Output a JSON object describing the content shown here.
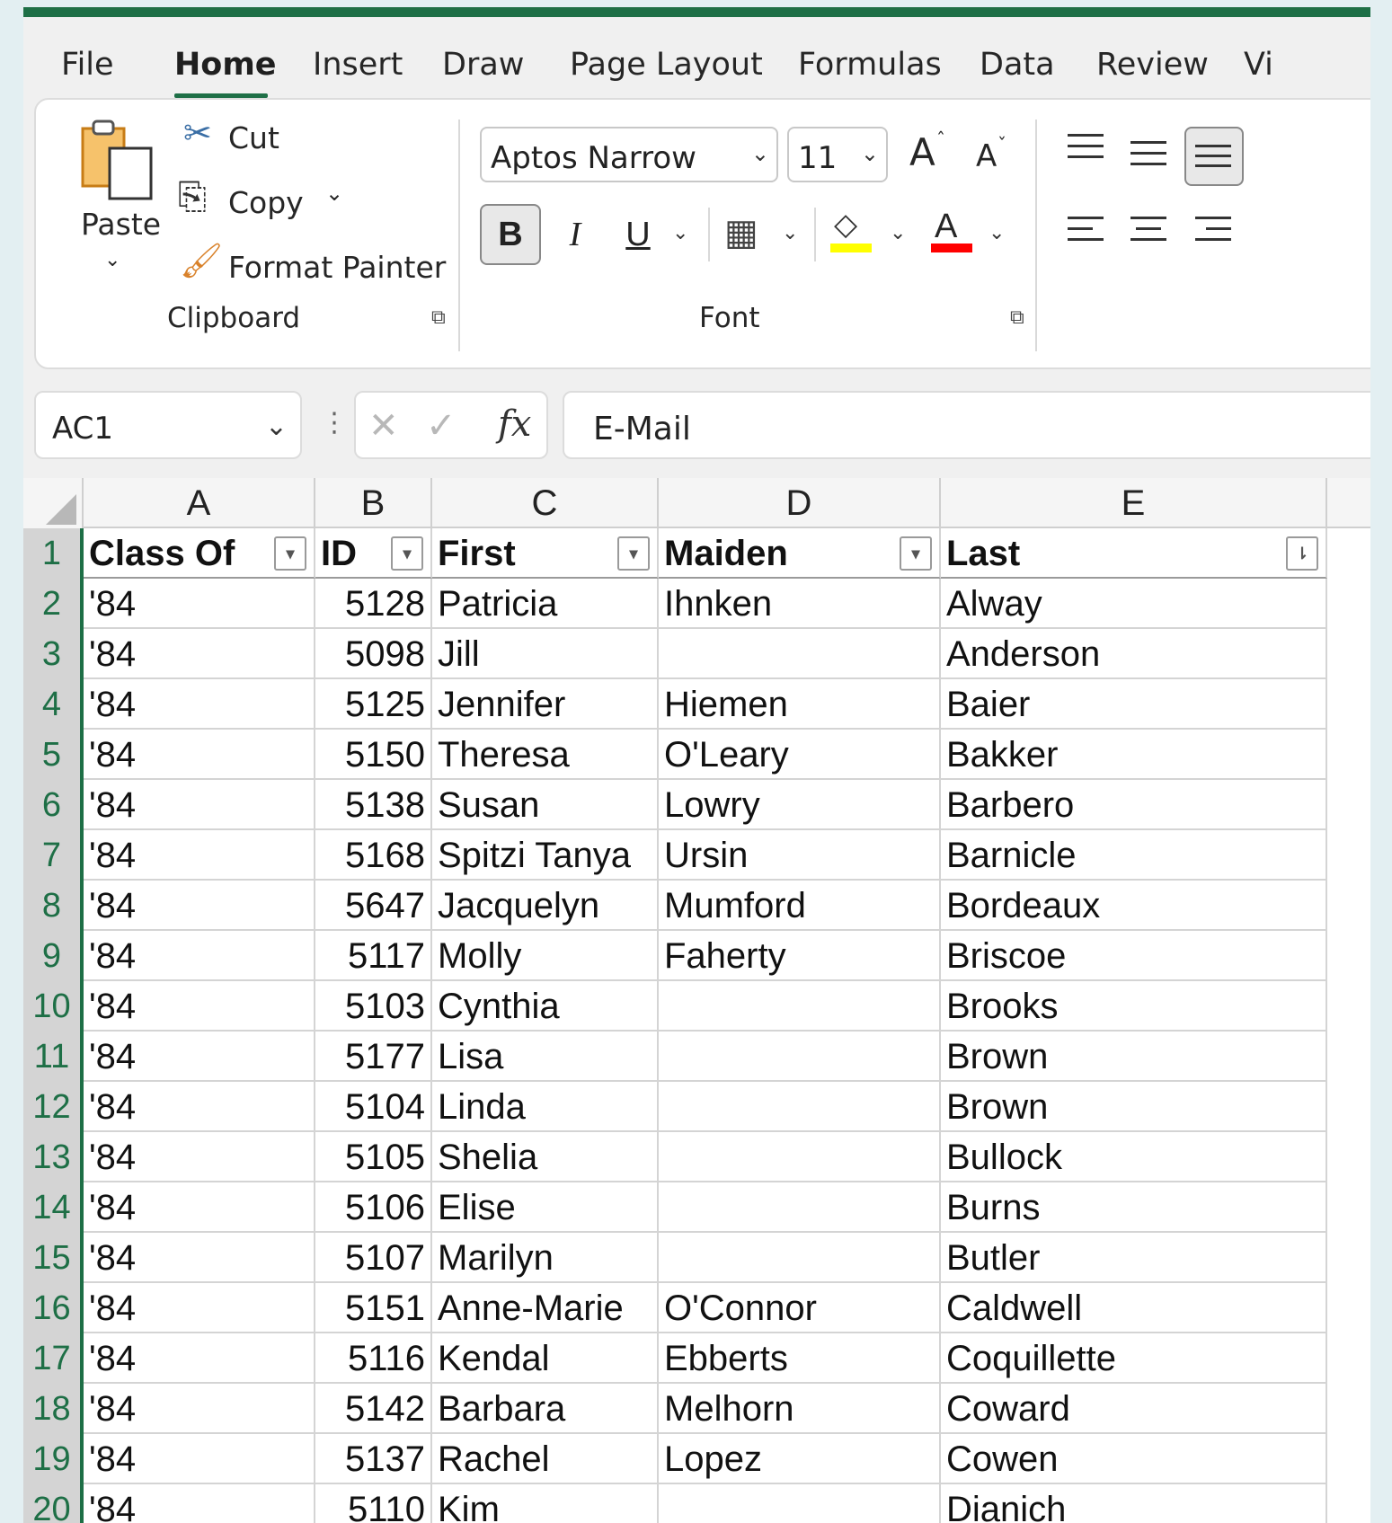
{
  "menu": {
    "tabs": [
      "File",
      "Home",
      "Insert",
      "Draw",
      "Page Layout",
      "Formulas",
      "Data",
      "Review",
      "Vi"
    ],
    "active_tab": "Home",
    "accent_color": "#1e6f46"
  },
  "ribbon": {
    "clipboard": {
      "paste_label": "Paste",
      "cut_label": "Cut",
      "copy_label": "Copy",
      "format_painter_label": "Format Painter",
      "group_label": "Clipboard"
    },
    "font": {
      "font_name": "Aptos Narrow",
      "font_size": "11",
      "increase_size_glyph": "A",
      "decrease_size_glyph": "A",
      "bold_glyph": "B",
      "italic_glyph": "I",
      "underline_glyph": "U",
      "font_color_glyph": "A",
      "group_label": "Font",
      "highlight_color": "#ffff00",
      "font_color": "#ff0000"
    }
  },
  "formula_bar": {
    "name_box": "AC1",
    "fx_label": "fx",
    "content": "E-Mail"
  },
  "sheet": {
    "columns": [
      "A",
      "B",
      "C",
      "D",
      "E"
    ],
    "header_row_number": "1",
    "headers": [
      "Class Of",
      "ID",
      "First",
      "Maiden",
      "Last"
    ],
    "rows": [
      {
        "n": "2",
        "cells": [
          "'84",
          "5128",
          "Patricia",
          "Ihnken",
          "Alway"
        ]
      },
      {
        "n": "3",
        "cells": [
          "'84",
          "5098",
          "Jill",
          "",
          "Anderson"
        ]
      },
      {
        "n": "4",
        "cells": [
          "'84",
          "5125",
          "Jennifer",
          "Hiemen",
          "Baier"
        ]
      },
      {
        "n": "5",
        "cells": [
          "'84",
          "5150",
          "Theresa",
          "O'Leary",
          "Bakker"
        ]
      },
      {
        "n": "6",
        "cells": [
          "'84",
          "5138",
          "Susan",
          "Lowry",
          "Barbero"
        ]
      },
      {
        "n": "7",
        "cells": [
          "'84",
          "5168",
          "Spitzi Tanya",
          "Ursin",
          "Barnicle"
        ]
      },
      {
        "n": "8",
        "cells": [
          "'84",
          "5647",
          "Jacquelyn",
          "Mumford",
          "Bordeaux"
        ]
      },
      {
        "n": "9",
        "cells": [
          "'84",
          "5117",
          "Molly",
          "Faherty",
          "Briscoe"
        ]
      },
      {
        "n": "10",
        "cells": [
          "'84",
          "5103",
          "Cynthia",
          "",
          "Brooks"
        ]
      },
      {
        "n": "11",
        "cells": [
          "'84",
          "5177",
          "Lisa",
          "",
          "Brown"
        ]
      },
      {
        "n": "12",
        "cells": [
          "'84",
          "5104",
          "Linda",
          "",
          "Brown"
        ]
      },
      {
        "n": "13",
        "cells": [
          "'84",
          "5105",
          "Shelia",
          "",
          "Bullock"
        ]
      },
      {
        "n": "14",
        "cells": [
          "'84",
          "5106",
          "Elise",
          "",
          "Burns"
        ]
      },
      {
        "n": "15",
        "cells": [
          "'84",
          "5107",
          "Marilyn",
          "",
          "Butler"
        ]
      },
      {
        "n": "16",
        "cells": [
          "'84",
          "5151",
          "Anne-Marie",
          "O'Connor",
          "Caldwell"
        ]
      },
      {
        "n": "17",
        "cells": [
          "'84",
          "5116",
          "Kendal",
          "Ebberts",
          "Coquillette"
        ]
      },
      {
        "n": "18",
        "cells": [
          "'84",
          "5142",
          "Barbara",
          "Melhorn",
          "Coward"
        ]
      },
      {
        "n": "19",
        "cells": [
          "'84",
          "5137",
          "Rachel",
          "Lopez",
          "Cowen"
        ]
      },
      {
        "n": "20",
        "cells": [
          "'84",
          "5110",
          "Kim",
          "",
          "Dianich"
        ]
      }
    ]
  }
}
